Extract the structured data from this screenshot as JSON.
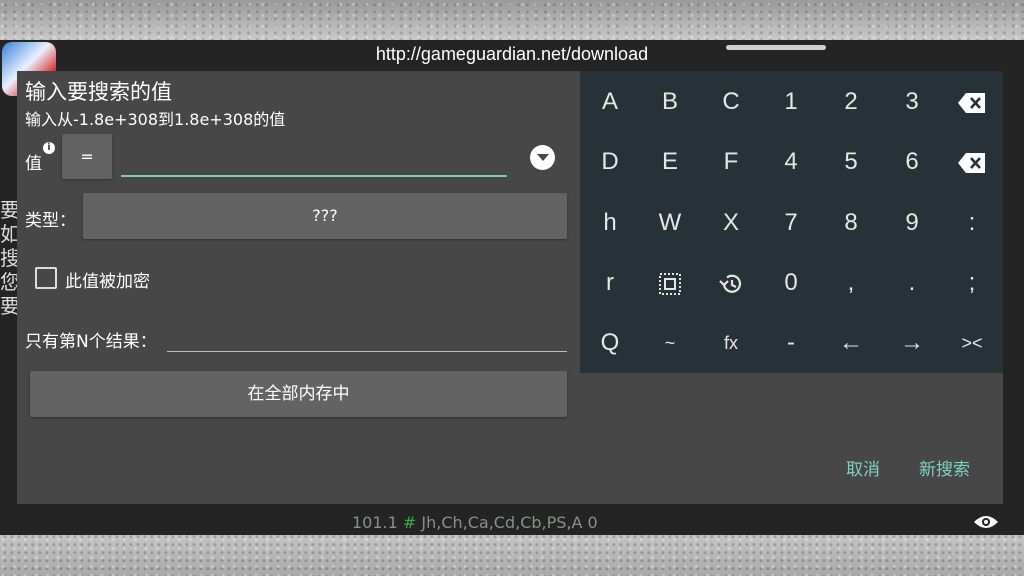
{
  "overlay": {
    "url": "http://gameguardian.net/download",
    "status_prefix": "101.1 ",
    "status_hash": "#",
    "status_suffix": " Jh,Ch,Ca,Cd,Cb,PS,A 0",
    "left_chars": [
      "要",
      "如",
      "搜",
      "您",
      "要"
    ]
  },
  "dialog": {
    "title": "输入要搜索的值",
    "subtitle": "输入从-1.8e+308到1.8e+308的值",
    "value_label": "值",
    "info_icon_text": "i",
    "operator": "=",
    "value_input": "",
    "type_label": "类型：",
    "type_value": "???",
    "encrypted_label": "此值被加密",
    "encrypted_checked": false,
    "nth_label": "只有第N个结果：",
    "nth_value": "",
    "memory_button": "在全部内存中",
    "cancel": "取消",
    "new_search": "新搜索"
  },
  "keypad": {
    "rows": [
      [
        "A",
        "B",
        "C",
        "1",
        "2",
        "3",
        "backspace"
      ],
      [
        "D",
        "E",
        "F",
        "4",
        "5",
        "6",
        "delete"
      ],
      [
        "h",
        "W",
        "X",
        "7",
        "8",
        "9",
        ":"
      ],
      [
        "r",
        "select-all",
        "history",
        "0",
        ",",
        ".",
        ";"
      ],
      [
        "Q",
        "~",
        "fx",
        "-",
        "←",
        "→",
        "><"
      ]
    ]
  },
  "colors": {
    "dialog_bg": "#474747",
    "keypad_bg": "#263238",
    "accent": "#7fd0c4",
    "button_bg": "#636363"
  }
}
